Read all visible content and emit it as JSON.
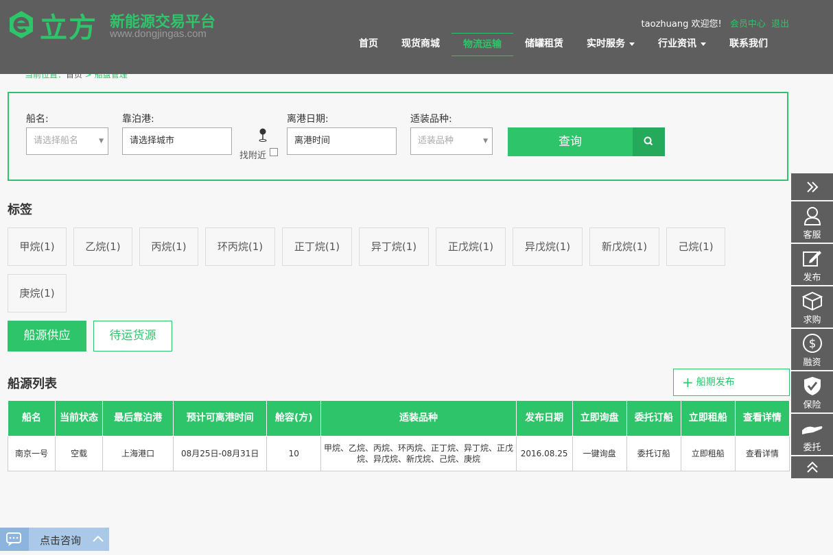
{
  "header": {
    "logo_text": "立方",
    "slogan": "新能源交易平台",
    "url": "www.dongjingas.com",
    "user": "taozhuang",
    "welcome": "欢迎您!",
    "member_center": "会员中心",
    "logout": "退出",
    "nav": [
      {
        "label": "首页",
        "active": false,
        "dropdown": false
      },
      {
        "label": "现货商城",
        "active": false,
        "dropdown": false
      },
      {
        "label": "物流运输",
        "active": true,
        "dropdown": false
      },
      {
        "label": "储罐租赁",
        "active": false,
        "dropdown": false
      },
      {
        "label": "实时服务",
        "active": false,
        "dropdown": true
      },
      {
        "label": "行业资讯",
        "active": false,
        "dropdown": true
      },
      {
        "label": "联系我们",
        "active": false,
        "dropdown": false
      }
    ]
  },
  "breadcrumb": {
    "prefix": "当前位置：",
    "home": "首页",
    "sep": ">",
    "current": "船盘管理"
  },
  "search": {
    "ship_label": "船名:",
    "ship_placeholder": "请选择船名",
    "port_label": "靠泊港:",
    "port_placeholder": "请选择城市",
    "nearby_label": "找附近",
    "date_label": "离港日期:",
    "date_placeholder": "离港时间",
    "product_label": "适装品种:",
    "product_placeholder": "适装品种",
    "query_button": "查询"
  },
  "tags": {
    "title": "标签",
    "items": [
      "甲烷(1)",
      "乙烷(1)",
      "丙烷(1)",
      "环丙烷(1)",
      "正丁烷(1)",
      "异丁烷(1)",
      "正戊烷(1)",
      "异戊烷(1)",
      "新戊烷(1)",
      "己烷(1)",
      "庚烷(1)"
    ]
  },
  "toggle": {
    "supply": "船源供应",
    "cargo": "待运货源"
  },
  "list": {
    "title": "船源列表",
    "publish": "船期发布",
    "headers": [
      "船名",
      "当前状态",
      "最后靠泊港",
      "预计可离港时间",
      "舱容(方)",
      "适装品种",
      "发布日期",
      "立即询盘",
      "委托订船",
      "立即租船",
      "查看详情"
    ],
    "rows": [
      [
        "南京一号",
        "空载",
        "上海港口",
        "08月25日-08月31日",
        "10",
        "甲烷、乙烷、丙烷、环丙烷、正丁烷、异丁烷、正戊烷、异戊烷、新戊烷、己烷、庚烷",
        "2016.08.25",
        "一键询盘",
        "委托订船",
        "立即租船",
        "查看详情"
      ]
    ]
  },
  "sidebar": {
    "items": [
      {
        "label": "",
        "icon": "double-chevron-right-icon"
      },
      {
        "label": "客服",
        "icon": "user-icon"
      },
      {
        "label": "发布",
        "icon": "edit-icon"
      },
      {
        "label": "求购",
        "icon": "box-icon"
      },
      {
        "label": "融资",
        "icon": "dollar-icon"
      },
      {
        "label": "保险",
        "icon": "shield-check-icon"
      },
      {
        "label": "委托",
        "icon": "hand-icon"
      },
      {
        "label": "",
        "icon": "double-chevron-up-icon"
      }
    ]
  },
  "consult": {
    "label": "点击咨询"
  },
  "colors": {
    "brand_green": "#2ec56a",
    "header_gray": "#5d5e5d"
  }
}
